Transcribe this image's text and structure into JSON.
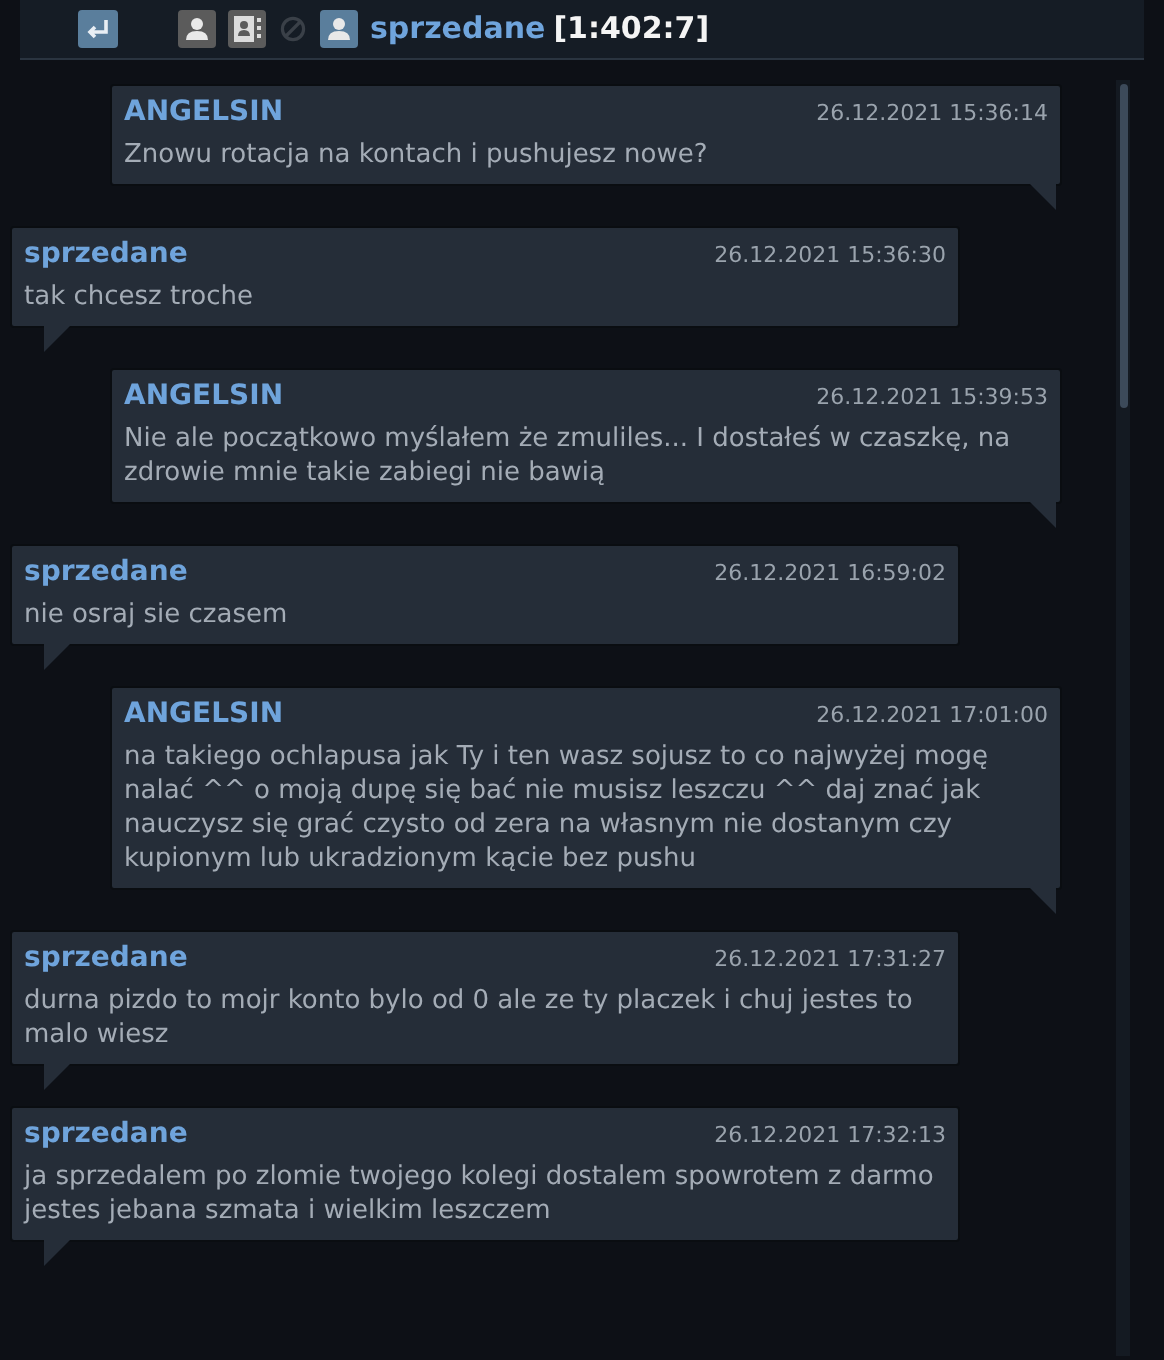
{
  "header": {
    "name": "sprzedane",
    "info": "[1:402:7]"
  },
  "messages": [
    {
      "kind": "own",
      "author": "ANGELSIN",
      "time": "26.12.2021 15:36:14",
      "text": "Znowu rotacja na kontach i pushujesz nowe?"
    },
    {
      "kind": "other",
      "author": "sprzedane",
      "time": "26.12.2021 15:36:30",
      "text": "tak chcesz troche"
    },
    {
      "kind": "own",
      "author": "ANGELSIN",
      "time": "26.12.2021 15:39:53",
      "text": "Nie ale początkowo myślałem że zmuliles... I dostałeś w czaszkę, na zdrowie mnie takie zabiegi nie bawią"
    },
    {
      "kind": "other",
      "author": "sprzedane",
      "time": "26.12.2021 16:59:02",
      "text": "nie osraj sie czasem"
    },
    {
      "kind": "own",
      "author": "ANGELSIN",
      "time": "26.12.2021 17:01:00",
      "text": "na takiego ochlapusa jak Ty i ten wasz sojusz to co najwyżej mogę nalać ^^ o moją dupę się bać nie musisz leszczu ^^ daj znać jak nauczysz się grać czysto od zera na własnym nie dostanym czy kupionym lub ukradzionym kącie bez pushu"
    },
    {
      "kind": "other",
      "author": "sprzedane",
      "time": "26.12.2021 17:31:27",
      "text": "durna pizdo to mojr konto bylo od 0 ale ze ty placzek i chuj jestes to malo wiesz"
    },
    {
      "kind": "other",
      "author": "sprzedane",
      "time": "26.12.2021 17:32:13",
      "text": "ja sprzedalem po zlomie twojego kolegi dostalem spowrotem z darmo jestes jebana szmata i wielkim leszczem"
    }
  ]
}
